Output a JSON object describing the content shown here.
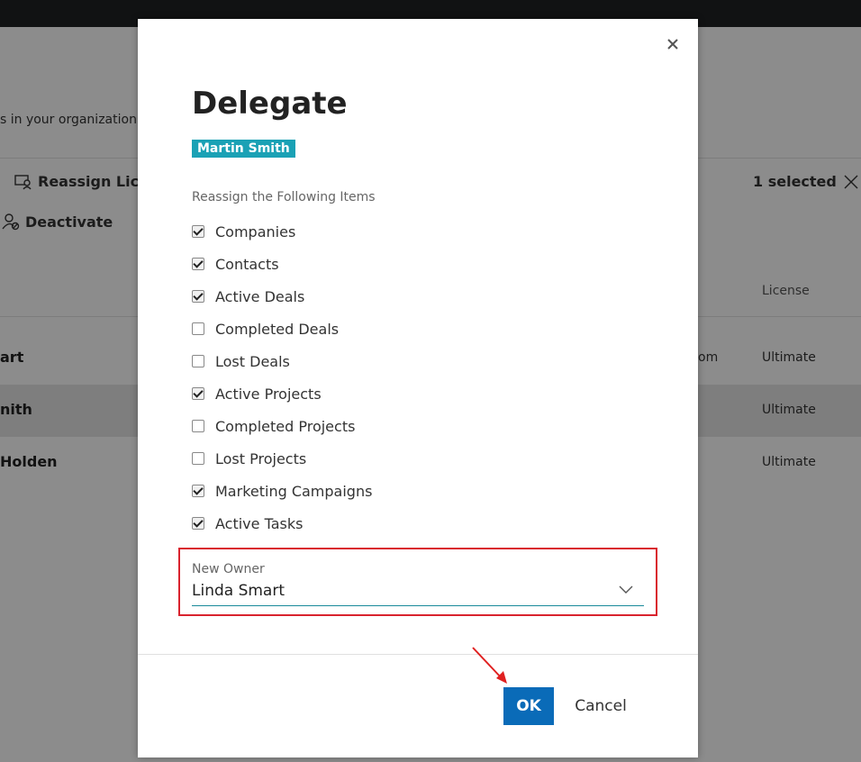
{
  "background": {
    "description_text": "s in your organization.",
    "commands": {
      "reassign_label": "Reassign Licen",
      "deactivate_label": "Deactivate"
    },
    "selection": {
      "count_label": "1 selected"
    },
    "table": {
      "license_header": "License",
      "rows": [
        {
          "name": "art",
          "email": "om",
          "license": "Ultimate",
          "selected": false
        },
        {
          "name": "nith",
          "email": "",
          "license": "Ultimate",
          "selected": true
        },
        {
          "name": "Holden",
          "email": "",
          "license": "Ultimate",
          "selected": false
        }
      ]
    }
  },
  "dialog": {
    "title": "Delegate",
    "user_badge": "Martin Smith",
    "section_label": "Reassign the Following Items",
    "items": [
      {
        "label": "Companies",
        "checked": true
      },
      {
        "label": "Contacts",
        "checked": true
      },
      {
        "label": "Active Deals",
        "checked": true
      },
      {
        "label": "Completed Deals",
        "checked": false
      },
      {
        "label": "Lost Deals",
        "checked": false
      },
      {
        "label": "Active Projects",
        "checked": true
      },
      {
        "label": "Completed Projects",
        "checked": false
      },
      {
        "label": "Lost Projects",
        "checked": false
      },
      {
        "label": "Marketing Campaigns",
        "checked": true
      },
      {
        "label": "Active Tasks",
        "checked": true
      }
    ],
    "new_owner": {
      "label": "New Owner",
      "value": "Linda Smart"
    },
    "buttons": {
      "ok": "OK",
      "cancel": "Cancel"
    }
  },
  "colors": {
    "badge": "#1aa1b5",
    "primary_button": "#0a6bb8",
    "highlight_border": "#d9232e",
    "annotation_arrow": "#e02020"
  },
  "icons": [
    "reassign-license-icon",
    "deactivate-user-icon",
    "clear-selection-icon",
    "close-icon",
    "chevron-down-icon",
    "annotation-arrow-icon"
  ]
}
